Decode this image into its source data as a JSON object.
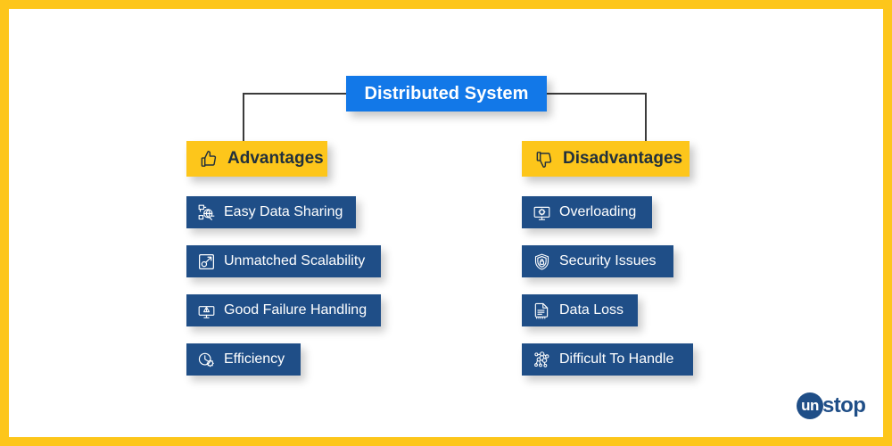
{
  "colors": {
    "frame_border": "#FDC61B",
    "root_node": "#1278E8",
    "branch_header": "#FDC61B",
    "leaf_node": "#1F4E87",
    "leaf_text": "#FFFFFF",
    "branch_text": "#21303C",
    "connector": "#3B3B3B",
    "logo": "#1F4E87",
    "background": "#FFFFFF"
  },
  "root": {
    "label": "Distributed System",
    "icon": "none"
  },
  "branches": [
    {
      "id": "advantages",
      "label": "Advantages",
      "icon": "thumbs-up-icon",
      "items": [
        {
          "label": "Easy Data Sharing",
          "icon": "data-sharing-network-icon"
        },
        {
          "label": "Unmatched Scalability",
          "icon": "scalability-expand-icon"
        },
        {
          "label": "Good Failure Handling",
          "icon": "monitor-warning-icon"
        },
        {
          "label": "Efficiency",
          "icon": "gear-speed-icon"
        }
      ]
    },
    {
      "id": "disadvantages",
      "label": "Disadvantages",
      "icon": "thumbs-down-icon",
      "items": [
        {
          "label": "Overloading",
          "icon": "monitor-overload-icon"
        },
        {
          "label": "Security Issues",
          "icon": "shield-lock-icon"
        },
        {
          "label": "Data Loss",
          "icon": "document-data-loss-icon"
        },
        {
          "label": "Difficult To Handle",
          "icon": "network-nodes-icon"
        }
      ]
    }
  ],
  "logo": {
    "mark_text": "un",
    "word_text": "stop",
    "name": "unstop-logo"
  }
}
